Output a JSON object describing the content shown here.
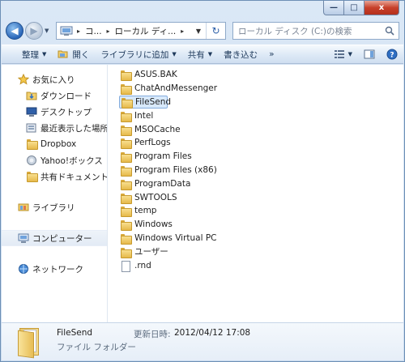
{
  "window": {
    "minimize_glyph": "—",
    "maximize_glyph": "□",
    "close_glyph": "x"
  },
  "address": {
    "crumbs": [
      "コ...",
      "ローカル ディ..."
    ],
    "search_placeholder": "ローカル ディスク (C:)の検索"
  },
  "toolbar": {
    "items": [
      {
        "label": "整理",
        "has_caret": true
      },
      {
        "label": "開く",
        "has_caret": false
      },
      {
        "label": "ライブラリに追加",
        "has_caret": true
      },
      {
        "label": "共有",
        "has_caret": true
      },
      {
        "label": "書き込む",
        "has_caret": false
      }
    ],
    "more": "»"
  },
  "nav": {
    "favorites": {
      "label": "お気に入り",
      "items": [
        {
          "label": "ダウンロード",
          "icon": "download-icon"
        },
        {
          "label": "デスクトップ",
          "icon": "desktop-icon"
        },
        {
          "label": "最近表示した場所",
          "icon": "recent-places-icon"
        },
        {
          "label": "Dropbox",
          "icon": "folder-icon"
        },
        {
          "label": "Yahoo!ボックス",
          "icon": "yahoo-box-icon"
        },
        {
          "label": "共有ドキュメント (",
          "icon": "folder-icon"
        }
      ]
    },
    "libraries": "ライブラリ",
    "computer": "コンピューター",
    "network": "ネットワーク"
  },
  "files": [
    {
      "name": "ASUS.BAK",
      "type": "folder"
    },
    {
      "name": "ChatAndMessenger",
      "type": "folder"
    },
    {
      "name": "FileSend",
      "type": "folder",
      "selected": true
    },
    {
      "name": "Intel",
      "type": "folder"
    },
    {
      "name": "MSOCache",
      "type": "folder"
    },
    {
      "name": "PerfLogs",
      "type": "folder"
    },
    {
      "name": "Program Files",
      "type": "folder"
    },
    {
      "name": "Program Files (x86)",
      "type": "folder"
    },
    {
      "name": "ProgramData",
      "type": "folder"
    },
    {
      "name": "SWTOOLS",
      "type": "folder"
    },
    {
      "name": "temp",
      "type": "folder"
    },
    {
      "name": "Windows",
      "type": "folder"
    },
    {
      "name": "Windows Virtual PC",
      "type": "folder"
    },
    {
      "name": "ユーザー",
      "type": "folder"
    },
    {
      "name": ".rnd",
      "type": "file"
    }
  ],
  "details": {
    "name": "FileSend",
    "type": "ファイル フォルダー",
    "date_label": "更新日時:",
    "date_value": "2012/04/12 17:08"
  }
}
